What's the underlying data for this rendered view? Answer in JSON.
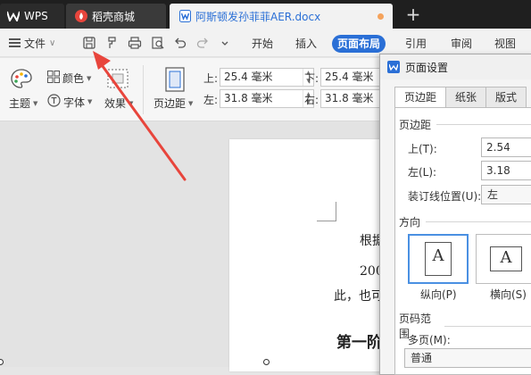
{
  "tabbar": {
    "wps_label": "WPS",
    "store_label": "稻壳商城",
    "doc_label": "阿斯顿发孙菲菲AER.docx",
    "new_tab": "+"
  },
  "menubar": {
    "file_label": "文件",
    "items": [
      "开始",
      "插入",
      "页面布局",
      "引用",
      "审阅",
      "视图"
    ],
    "active_item": "页面布局"
  },
  "ribbon": {
    "theme_label": "主题",
    "color_label": "颜色",
    "font_label": "字体",
    "effect_label": "效果",
    "margin_label": "页边距",
    "top_label": "上:",
    "top_value": "25.4 毫米",
    "bottom_label": "下:",
    "bottom_value": "25.4 毫米",
    "left_label": "左:",
    "left_value": "31.8 毫米",
    "right_label": "右:",
    "right_value": "31.8 毫米"
  },
  "document": {
    "line1": "根据",
    "line2": "200",
    "line3": "此，也可",
    "heading": "第一阶"
  },
  "dialog": {
    "title": "页面设置",
    "tabs": [
      "页边距",
      "纸张",
      "版式"
    ],
    "active_tab": "页边距",
    "margins_group": "页边距",
    "top_label": "上(T):",
    "top_value": "2.54",
    "left_label": "左(L):",
    "left_value": "3.18",
    "gutter_label": "装订线位置(U):",
    "gutter_value": "左",
    "orientation_group": "方向",
    "portrait_label": "纵向(P)",
    "landscape_label": "横向(S)",
    "paper_glyph": "A",
    "page_range_group": "页码范围",
    "multi_page_label": "多页(M):",
    "multi_page_value": "普通"
  },
  "colors": {
    "accent": "#2a6fd6",
    "arrow": "#e8453c",
    "tabbar_bg": "#1f1f1f"
  }
}
